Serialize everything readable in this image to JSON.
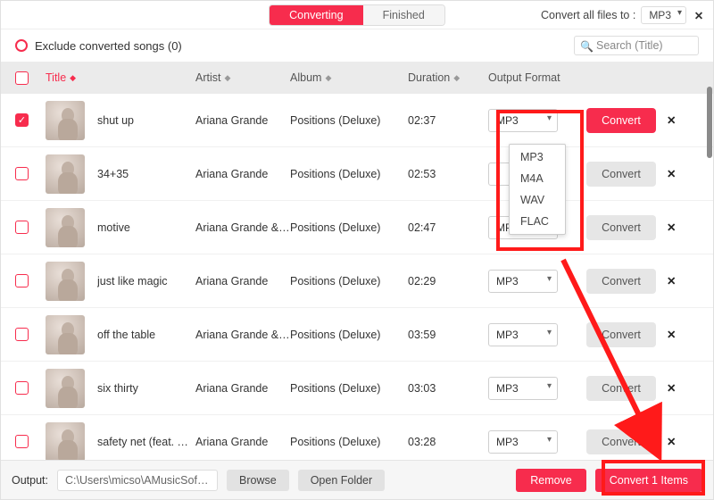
{
  "topbar": {
    "tab_converting": "Converting",
    "tab_finished": "Finished",
    "convert_all_label": "Convert all files to :",
    "convert_all_value": "MP3"
  },
  "filter": {
    "label": "Exclude converted songs (0)"
  },
  "search": {
    "placeholder": "Search  (Title)"
  },
  "columns": {
    "title": "Title",
    "artist": "Artist",
    "album": "Album",
    "duration": "Duration",
    "output_format": "Output Format"
  },
  "dropdown_open_row": 0,
  "format_options": [
    "MP3",
    "M4A",
    "WAV",
    "FLAC"
  ],
  "convert_label": "Convert",
  "tracks": [
    {
      "checked": true,
      "title": "shut up",
      "artist": "Ariana Grande",
      "album": "Positions (Deluxe)",
      "duration": "02:37",
      "format": "MP3",
      "primary": true
    },
    {
      "checked": false,
      "title": "34+35",
      "artist": "Ariana Grande",
      "album": "Positions (Deluxe)",
      "duration": "02:53",
      "format": "",
      "primary": false
    },
    {
      "checked": false,
      "title": "motive",
      "artist": "Ariana Grande & ...",
      "album": "Positions (Deluxe)",
      "duration": "02:47",
      "format": "MP3",
      "primary": false
    },
    {
      "checked": false,
      "title": "just like magic",
      "artist": "Ariana Grande",
      "album": "Positions (Deluxe)",
      "duration": "02:29",
      "format": "MP3",
      "primary": false
    },
    {
      "checked": false,
      "title": "off the table",
      "artist": "Ariana Grande & ...",
      "album": "Positions (Deluxe)",
      "duration": "03:59",
      "format": "MP3",
      "primary": false
    },
    {
      "checked": false,
      "title": "six thirty",
      "artist": "Ariana Grande",
      "album": "Positions (Deluxe)",
      "duration": "03:03",
      "format": "MP3",
      "primary": false
    },
    {
      "checked": false,
      "title": "safety net (feat. Ty ...",
      "artist": "Ariana Grande",
      "album": "Positions (Deluxe)",
      "duration": "03:28",
      "format": "MP3",
      "primary": false
    }
  ],
  "footer": {
    "output_label": "Output:",
    "output_path": "C:\\Users\\micso\\AMusicSoft ...",
    "browse": "Browse",
    "open_folder": "Open Folder",
    "remove": "Remove",
    "convert_items": "Convert 1 Items"
  }
}
